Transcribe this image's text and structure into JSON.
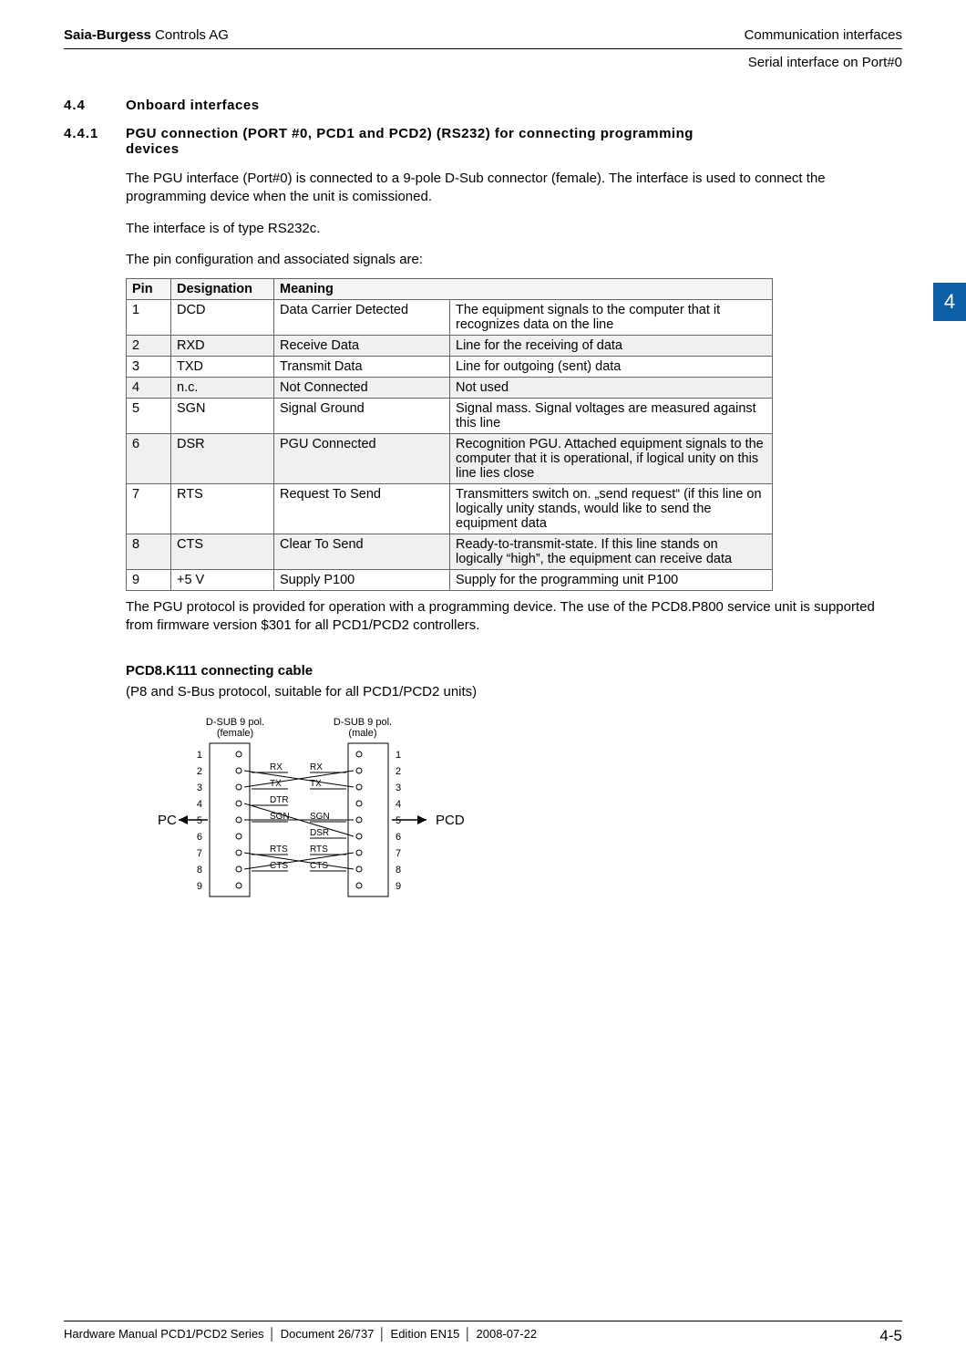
{
  "header": {
    "company_bold": "Saia-Burgess",
    "company_rest": " Controls AG",
    "right": "Communication interfaces",
    "sub_right": "Serial interface on Port#0"
  },
  "side_tab": "4",
  "sec44_num": "4.4",
  "sec44_title": "Onboard interfaces",
  "sec441_num": "4.4.1",
  "sec441_title": "PGU connection (PORT #0, PCD1 and PCD2) (RS232) for connecting programming devices",
  "p1": "The PGU interface (Port#0) is connected to a 9-pole D-Sub connector (female). The interface is used to connect the programming device when the unit is comissioned.",
  "p2": "The interface is of type RS232c.",
  "p3": "The pin configuration and associated signals are:",
  "table": {
    "h1": "Pin",
    "h2": "Designation",
    "h3": "Meaning",
    "rows": [
      {
        "pin": "1",
        "des": "DCD",
        "m1": "Data Carrier Detected",
        "m2": "The equipment signals to the computer that it recognizes data on the line"
      },
      {
        "pin": "2",
        "des": "RXD",
        "m1": "Receive Data",
        "m2": "Line for the receiving of data"
      },
      {
        "pin": "3",
        "des": "TXD",
        "m1": "Transmit Data",
        "m2": "Line for outgoing (sent) data"
      },
      {
        "pin": "4",
        "des": "n.c.",
        "m1": "Not Connected",
        "m2": "Not used"
      },
      {
        "pin": "5",
        "des": "SGN",
        "m1": "Signal Ground",
        "m2": "Signal mass. Signal voltages are measured against this line"
      },
      {
        "pin": "6",
        "des": "DSR",
        "m1": "PGU Connected",
        "m2": "Recognition PGU. Attached equipment signals to the computer that it is operational, if logical unity on this line lies close"
      },
      {
        "pin": "7",
        "des": "RTS",
        "m1": "Request To Send",
        "m2": "Transmitters switch on. „send request“ (if this line on logically unity stands, would like to send the equipment data"
      },
      {
        "pin": "8",
        "des": "CTS",
        "m1": "Clear To Send",
        "m2": "Ready-to-transmit-state. If this line stands on logically “high”, the equipment can receive data"
      },
      {
        "pin": "9",
        "des": "+5 V",
        "m1": "Supply P100",
        "m2": "Supply for the programming unit P100"
      }
    ]
  },
  "p4": "The PGU protocol is provided for operation with a programming device. The use of the PCD8.P800 service unit is supported from firmware version $301 for all PCD1/PCD2 controllers.",
  "cable_title": "PCD8.K111 connecting cable",
  "cable_sub": "(P8 and S-Bus protocol, suitable for all PCD1/PCD2 units)",
  "diagram": {
    "left_header": "D-SUB 9 pol.\n(female)",
    "right_header": "D-SUB 9 pol.\n(male)",
    "pc_label": "PC",
    "pcd_label": "PCD",
    "left_pins": [
      "1",
      "2",
      "3",
      "4",
      "5",
      "6",
      "7",
      "8",
      "9"
    ],
    "right_pins": [
      "1",
      "2",
      "3",
      "4",
      "5",
      "6",
      "7",
      "8",
      "9"
    ],
    "signals_left": {
      "2": "RX",
      "3": "TX",
      "4": "DTR",
      "5": "SGN",
      "7": "RTS",
      "8": "CTS"
    },
    "signals_right": {
      "2": "RX",
      "3": "TX",
      "5": "SGN",
      "6": "DSR",
      "7": "RTS",
      "8": "CTS"
    },
    "connections": [
      {
        "from": 2,
        "to": 3
      },
      {
        "from": 3,
        "to": 2
      },
      {
        "from": 5,
        "to": 5
      },
      {
        "from": 4,
        "to": 6
      },
      {
        "from": 7,
        "to": 8
      },
      {
        "from": 8,
        "to": 7
      }
    ]
  },
  "footer": {
    "parts": [
      "Hardware Manual PCD1/PCD2 Series",
      "Document 26/737",
      "Edition EN15",
      "2008-07-22"
    ],
    "page": "4-5"
  }
}
